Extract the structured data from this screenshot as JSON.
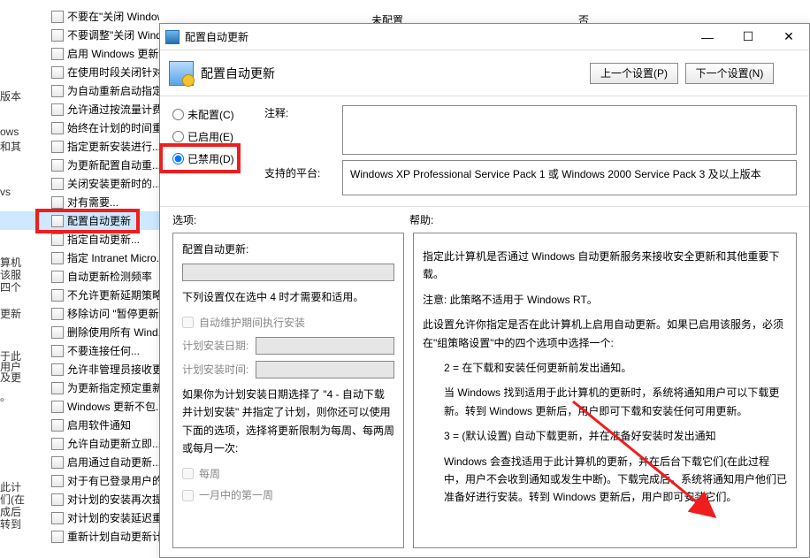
{
  "bg": {
    "col2": "未配置",
    "col3": "否",
    "tree": [
      "不要在\"关闭 Windows\"对话框显示\"安装更新并关机\"",
      "不要调整\"关闭 Wind...",
      "启用 Windows 更新...",
      "在使用时段关闭针对...",
      "为自动重新启动指定...",
      "允许通过按流量计费...",
      "始终在计划的时间重...",
      "指定更新安装进行...",
      "为更新配置自动重...",
      "关闭安装更新时的...",
      "对有需要...",
      "配置自动更新",
      "指定自动更新...",
      "指定 Intranet Micro...",
      "自动更新检测频率",
      "不允许更新延期策略...",
      "移除访问 \"暂停更新...",
      "删除使用所有 Wind...",
      "不要连接任何...",
      "允许非管理员接收更...",
      "为更新指定预定重新...",
      "Windows 更新不包...",
      "启用软件通知",
      "允许自动更新立即...",
      "启用通过自动更新...",
      "对于有已登录用户的...",
      "对计划的安装再次提...",
      "对计划的安装延迟重...",
      "重新计划自动更新计..."
    ],
    "side": [
      "版本",
      "ows",
      "和其",
      "vs",
      "算机",
      "该服",
      "四个",
      "更新",
      "于此",
      "用户",
      "及更",
      "。",
      "此计",
      "们(在",
      "成后",
      "转到"
    ]
  },
  "dialog": {
    "title": "配置自动更新",
    "header_title": "配置自动更新",
    "prev": "上一个设置(P)",
    "next": "下一个设置(N)",
    "radio_unconfigured": "未配置(C)",
    "radio_enabled": "已启用(E)",
    "radio_disabled": "已禁用(D)",
    "lbl_comment": "注释:",
    "lbl_platform": "支持的平台:",
    "platform_text": "Windows XP Professional Service Pack 1 或 Windows 2000 Service Pack 3 及以上版本",
    "lbl_options": "选项:",
    "lbl_help": "帮助:",
    "options": {
      "heading": "配置自动更新:",
      "note": "下列设置仅在选中 4 时才需要和适用。",
      "auto_maint": "自动维护期间执行安装",
      "plan_date": "计划安装日期:",
      "plan_time": "计划安装时间:",
      "plan_paragraph": "如果你为计划安装日期选择了 \"4 - 自动下载并计划安装\" 并指定了计划，则你还可以使用下面的选项，选择将更新限制为每周、每两周或每月一次:",
      "weekly": "每周",
      "first_week": "一月中的第一周"
    },
    "help": {
      "p1": "指定此计算机是否通过 Windows 自动更新服务来接收安全更新和其他重要下载。",
      "p2": "注意: 此策略不适用于 Windows RT。",
      "p3": "此设置允许你指定是否在此计算机上启用自动更新。如果已启用该服务，必须在\"组策略设置\"中的四个选项中选择一个:",
      "p4": "2 = 在下载和安装任何更新前发出通知。",
      "p5": "当 Windows 找到适用于此计算机的更新时，系统将通知用户可以下载更新。转到 Windows 更新后，用户即可下载和安装任何可用更新。",
      "p6": "3 = (默认设置) 自动下载更新，并在准备好安装时发出通知",
      "p7": "Windows 会查找适用于此计算机的更新，并在后台下载它们(在此过程中，用户不会收到通知或发生中断)。下载完成后，系统将通知用户他们已准备好进行安装。转到 Windows 更新后，用户即可安装它们。"
    }
  }
}
